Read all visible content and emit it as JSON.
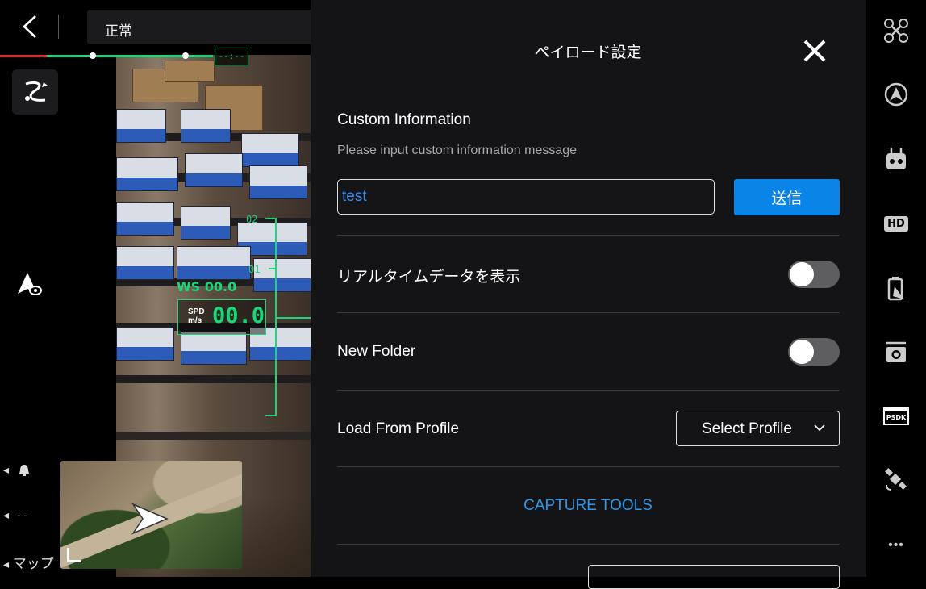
{
  "top_bar": {
    "status": "正常",
    "progress_label": "--:--"
  },
  "hud": {
    "tick_top": "02",
    "tick_mid": "01",
    "ws": "WS 00.0",
    "spd_label_line1": "SPD",
    "spd_label_line2": "m/s",
    "spd_value": "00.0"
  },
  "left_indicators": {
    "dash": "- -",
    "map": "マップ"
  },
  "settings_panel": {
    "title": "ペイロード設定",
    "custom_info": {
      "label": "Custom Information",
      "hint": "Please input custom information message",
      "value": "test",
      "send_label": "送信"
    },
    "rows": {
      "realtime_label": "リアルタイムデータを表示",
      "realtime_on": false,
      "new_folder_label": "New Folder",
      "new_folder_on": false,
      "load_profile_label": "Load From Profile",
      "select_profile_value": "Select Profile"
    },
    "capture_tools": "CAPTURE TOOLS"
  },
  "right_toolbar": {
    "icons": [
      "drone-icon",
      "flight-mode-icon",
      "remote-controller-icon",
      "hd-icon",
      "battery-icon",
      "camera-icon",
      "psdk-icon",
      "rtk-satellite-icon",
      "more-icon"
    ],
    "hd_label": "HD",
    "psdk_label": "PSDK",
    "more_label": "•••"
  },
  "colors": {
    "accent_blue": "#0b84e8",
    "link_blue": "#2b97ea",
    "hud_green": "#1ad67a",
    "progress_red": "#e0262b",
    "panel_bg": "#161618"
  }
}
